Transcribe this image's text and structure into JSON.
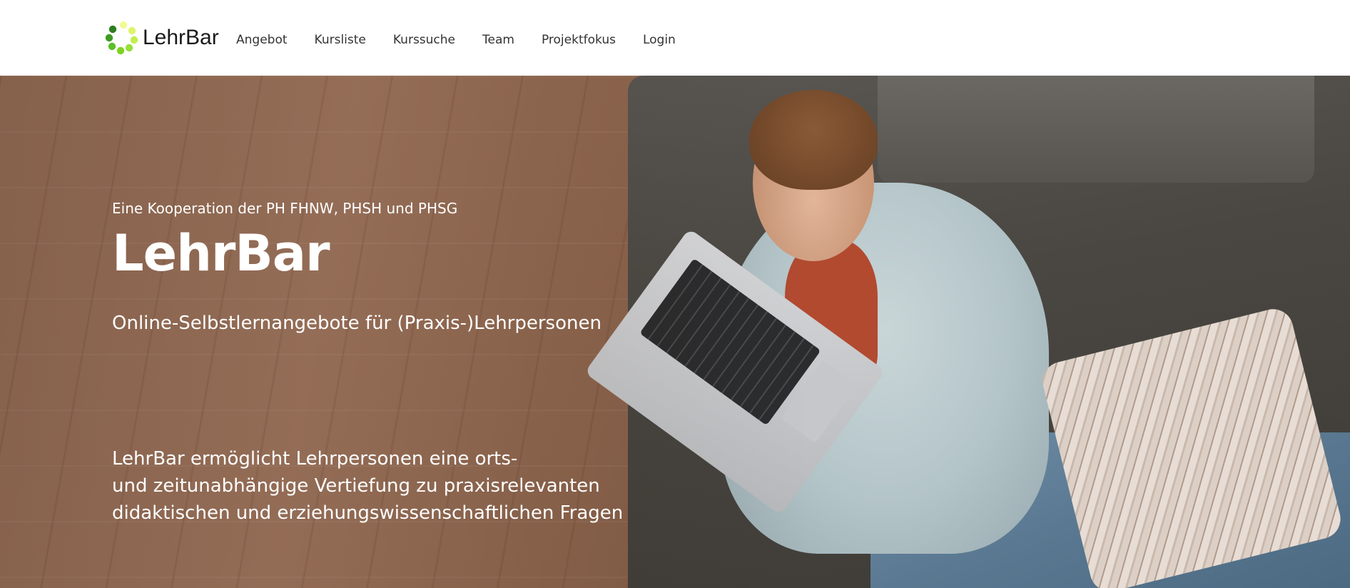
{
  "header": {
    "logo_text": "LehrBar",
    "logo_icon": "dot-ring-icon",
    "logo_colors": [
      "#2e7d1e",
      "#4caf2a",
      "#7ed321",
      "#b6e43a",
      "#e8f56a"
    ],
    "nav": [
      {
        "label": "Angebot"
      },
      {
        "label": "Kursliste"
      },
      {
        "label": "Kurssuche"
      },
      {
        "label": "Team"
      },
      {
        "label": "Projektfokus"
      },
      {
        "label": "Login"
      }
    ]
  },
  "hero": {
    "eyebrow": "Eine Kooperation der PH FHNW, PHSH und PHSG",
    "title": "LehrBar",
    "subtitle": "Online-Selbstlernangebote für (Praxis-)Lehrpersonen",
    "description_lines": [
      "LehrBar ermöglicht Lehrpersonen eine orts-",
      "und zeitunabhängige Vertiefung zu praxisrelevanten",
      "didaktischen und erziehungswissenschaftlichen Fragen"
    ]
  }
}
